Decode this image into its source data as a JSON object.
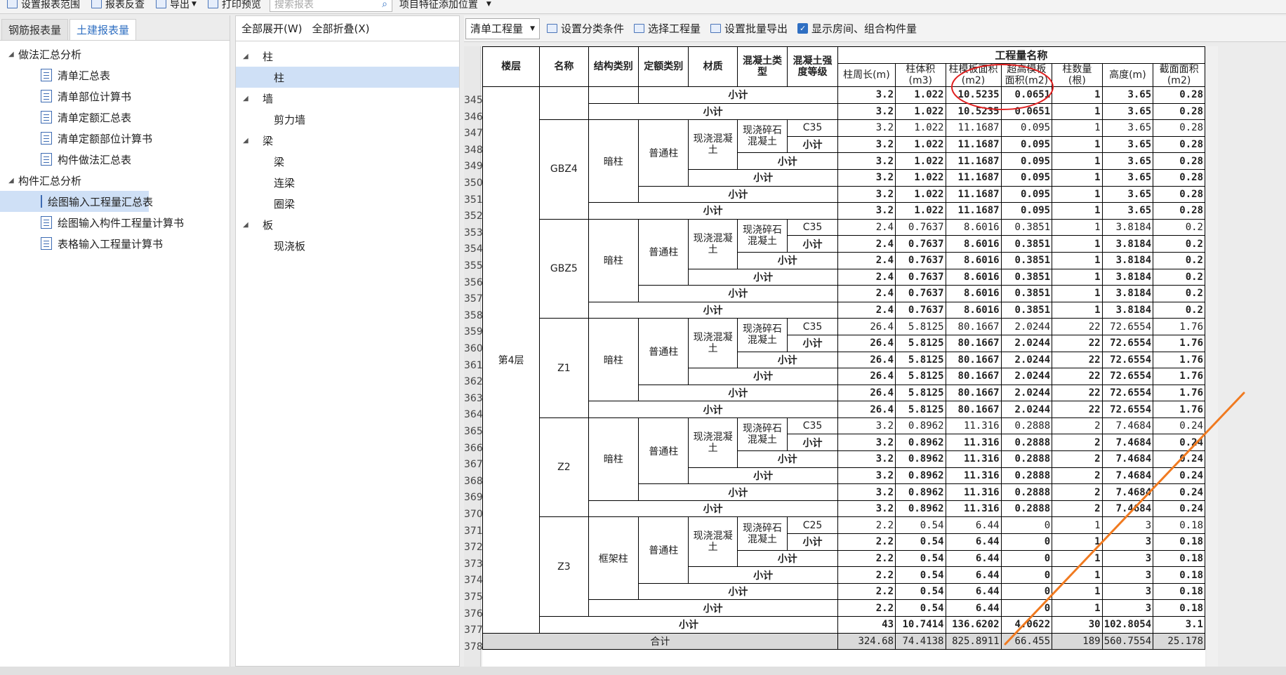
{
  "topbar": {
    "items": [
      "设置报表范围",
      "报表反查",
      "导出",
      "打印预览"
    ],
    "search_placeholder": "搜索报表",
    "search_icon": "search-icon",
    "position_label": "项目特征添加位置"
  },
  "left": {
    "tabs": [
      "钢筋报表量",
      "土建报表量"
    ],
    "active_tab": "土建报表量",
    "groups": [
      {
        "label": "做法汇总分析",
        "items": [
          "清单汇总表",
          "清单部位计算书",
          "清单定额汇总表",
          "清单定额部位计算书",
          "构件做法汇总表"
        ]
      },
      {
        "label": "构件汇总分析",
        "items": [
          "绘图输入工程量汇总表",
          "绘图输入构件工程量计算书",
          "表格输入工程量计算书"
        ]
      }
    ],
    "selected": "绘图输入工程量汇总表"
  },
  "middle": {
    "expand_all": "全部展开(W)",
    "collapse_all": "全部折叠(X)",
    "groups": [
      {
        "label": "柱",
        "items": [
          "柱"
        ]
      },
      {
        "label": "墙",
        "items": [
          "剪力墙"
        ]
      },
      {
        "label": "梁",
        "items": [
          "梁",
          "连梁",
          "圈梁"
        ]
      },
      {
        "label": "板",
        "items": [
          "现浇板"
        ]
      }
    ],
    "selected": "柱"
  },
  "toolbar": {
    "combo_value": "清单工程量",
    "buttons": [
      "设置分类条件",
      "选择工程量",
      "设置批量导出"
    ],
    "checkbox_label": "显示房间、组合构件量",
    "checkbox_checked": true
  },
  "table": {
    "headers": {
      "floor": "楼层",
      "name": "名称",
      "struct": "结构类别",
      "quota": "定额类别",
      "material": "材质",
      "concrete_type": "混凝土类型",
      "concrete_grade": "混凝土强度等级",
      "qty_group": "工程量名称",
      "perimeter": "柱周长(m)",
      "volume": "柱体积(m3)",
      "formwork": "柱模板面积(m2)",
      "super_formwork": "超高模板面积(m2)",
      "count": "柱数量(根)",
      "height": "高度(m)",
      "section": "截面面积(m2)"
    },
    "floor_label": "第4层",
    "subtotal": "小计",
    "total_label": "合计",
    "material_label": "现浇混凝土",
    "concrete_label": "现浇碎石混凝土",
    "quota_label": "普通柱",
    "row_numbers": [
      345,
      346,
      347,
      348,
      349,
      350,
      351,
      352,
      353,
      354,
      355,
      356,
      357,
      358,
      359,
      360,
      361,
      362,
      363,
      364,
      365,
      366,
      367,
      368,
      369,
      370,
      371,
      372,
      373,
      374,
      375,
      376,
      377,
      378
    ],
    "top_rows": [
      [
        "3.2",
        "1.022",
        "10.5235",
        "0.0651",
        "1",
        "3.65",
        "0.28"
      ],
      [
        "3.2",
        "1.022",
        "10.5235",
        "0.0651",
        "1",
        "3.65",
        "0.28"
      ]
    ],
    "components": [
      {
        "name": "GBZ4",
        "struct": "暗柱",
        "grade": "C35",
        "values": [
          "3.2",
          "1.022",
          "11.1687",
          "0.095",
          "1",
          "3.65",
          "0.28"
        ]
      },
      {
        "name": "GBZ5",
        "struct": "暗柱",
        "grade": "C35",
        "values": [
          "2.4",
          "0.7637",
          "8.6016",
          "0.3851",
          "1",
          "3.8184",
          "0.2"
        ]
      },
      {
        "name": "Z1",
        "struct": "暗柱",
        "grade": "C35",
        "values": [
          "26.4",
          "5.8125",
          "80.1667",
          "2.0244",
          "22",
          "72.6554",
          "1.76"
        ]
      },
      {
        "name": "Z2",
        "struct": "暗柱",
        "grade": "C35",
        "values": [
          "3.2",
          "0.8962",
          "11.316",
          "0.2888",
          "2",
          "7.4684",
          "0.24"
        ]
      },
      {
        "name": "Z3",
        "struct": "框架柱",
        "grade": "C25",
        "values": [
          "2.2",
          "0.54",
          "6.44",
          "0",
          "1",
          "3",
          "0.18"
        ]
      }
    ],
    "floor_subtotal": [
      "43",
      "10.7414",
      "136.6202",
      "4.0622",
      "30",
      "102.8054",
      "3.1"
    ],
    "grand_total": [
      "324.68",
      "74.4138",
      "825.8911",
      "66.455",
      "189",
      "560.7554",
      "25.178"
    ]
  }
}
